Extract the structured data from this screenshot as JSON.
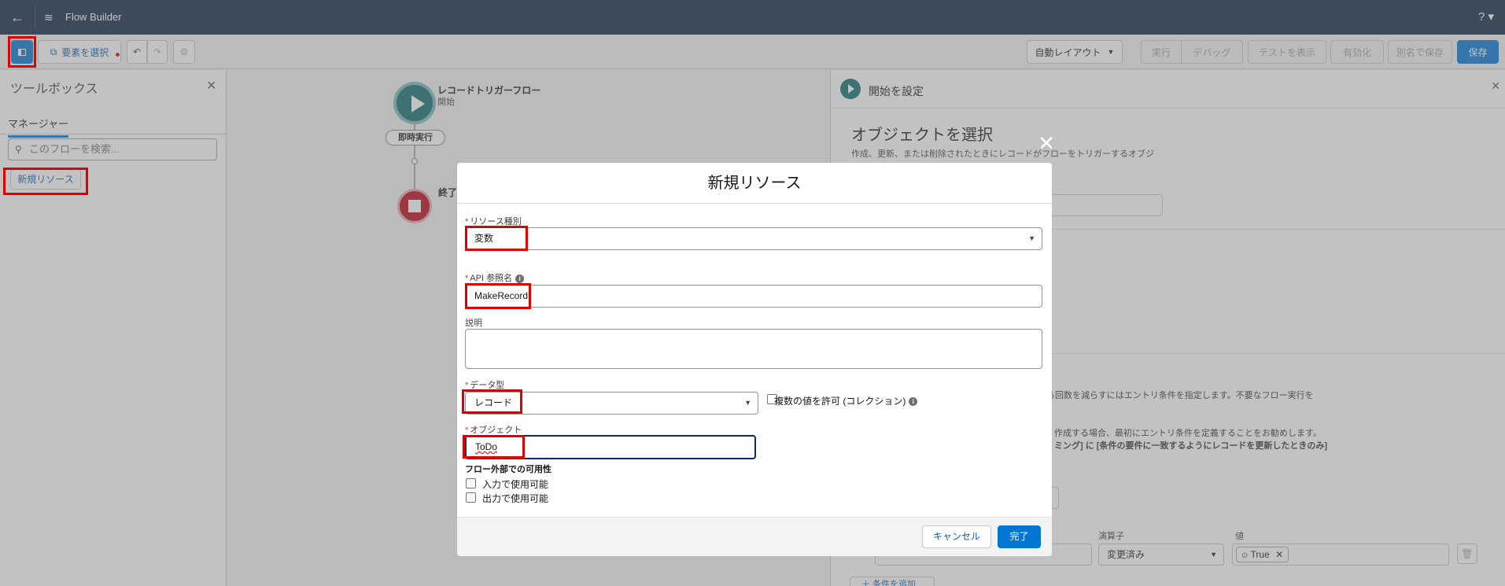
{
  "topbar": {
    "back_icon": "arrow-left-icon",
    "flow_icon": "flow-icon",
    "app_title": "Flow Builder",
    "help_label": "? ▾"
  },
  "toolbar": {
    "select_elements_label": "要素を選択",
    "auto_layout_label": "自動レイアウト",
    "run_label": "実行",
    "debug_label": "デバッグ",
    "show_test_label": "テストを表示",
    "activate_label": "有効化",
    "save_as_label": "別名で保存",
    "save_label": "保存"
  },
  "toolbox": {
    "title": "ツールボックス",
    "tab_manager": "マネージャー",
    "search_placeholder": "このフローを検索...",
    "new_resource_label": "新規リソース"
  },
  "canvas": {
    "start_title": "レコードトリガーフロー",
    "start_subtitle": "開始",
    "run_immediately": "即時実行",
    "end_label": "終了"
  },
  "right_panel": {
    "header_title": "開始を設定",
    "heading": "オブジェクトを選択",
    "description": "作成、更新、または削除されたときにレコードがフローをトリガーするオブジ",
    "text_entry": "る回数を減らすにはエントリ条件を指定します。不要なフロー実行を",
    "text_recommend": "作成する場合、最初にエントリ条件を定義することをお勧めします。",
    "text_timing": "ミング] に [条件の要件に一致するようにレコードを更新したときのみ]",
    "operator_label": "演算子",
    "value_label": "値",
    "operator_value": "変更済み",
    "value_pill": "True",
    "field_value": "",
    "add_condition": "条件を追加"
  },
  "modal": {
    "title": "新規リソース",
    "resource_type_label": "リソース種別",
    "resource_type_value": "変数",
    "api_name_label": "API 参照名",
    "api_name_value": "MakeRecord",
    "description_label": "説明",
    "data_type_label": "データ型",
    "data_type_value": "レコード",
    "allow_multiple_label": "複数の値を許可 (コレクション)",
    "object_label": "オブジェクト",
    "object_value": "ToDo",
    "availability_title": "フロー外部での可用性",
    "available_input_label": "入力で使用可能",
    "available_output_label": "出力で使用可能",
    "cancel_label": "キャンセル",
    "done_label": "完了"
  }
}
